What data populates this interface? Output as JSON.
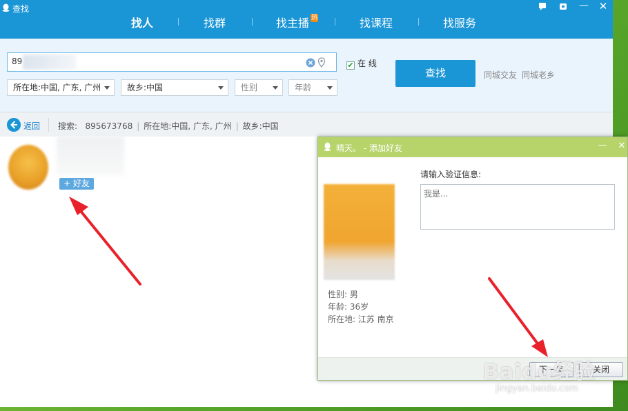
{
  "window": {
    "title": "查找",
    "nav_tabs": [
      {
        "label": "找人",
        "active": true
      },
      {
        "label": "找群"
      },
      {
        "label": "找主播",
        "badge": "热"
      },
      {
        "label": "找课程"
      },
      {
        "label": "找服务"
      }
    ],
    "title_buttons": [
      "feedback-icon",
      "skin-icon",
      "minimize-icon",
      "close-icon"
    ]
  },
  "search": {
    "query_value": "89",
    "online_label": "在 线",
    "online_checked": true,
    "filters": [
      {
        "label": "所在地:中国, 广东, 广州",
        "placeholder": false
      },
      {
        "label": "故乡:中国",
        "placeholder": false
      },
      {
        "label": "性别",
        "placeholder": true
      },
      {
        "label": "年龄",
        "placeholder": true
      }
    ],
    "find_button": "查找",
    "links": [
      "同城交友",
      "同城老乡"
    ]
  },
  "breadcrumb": {
    "back_label": "返回",
    "search_label": "搜索:",
    "query": "895673768",
    "location": "所在地:中国, 广东, 广州",
    "hometown": "故乡:中国"
  },
  "result": {
    "add_friend_label": "+ 好友"
  },
  "dialog": {
    "title": "晴天。 - 添加好友",
    "gender": "性别: 男",
    "age": "年龄: 36岁",
    "location": "所在地: 江苏  南京",
    "verify_label": "请输入验证信息:",
    "verify_placeholder": "我是...",
    "next_button": "下一步",
    "close_button": "关闭"
  },
  "watermark": {
    "logo_text": "Baidu经验",
    "url": "jingyan.baidu.com"
  },
  "colors": {
    "accent": "#1a95d6",
    "dialog_title": "#b6d46a",
    "arrow": "#e8212a"
  }
}
